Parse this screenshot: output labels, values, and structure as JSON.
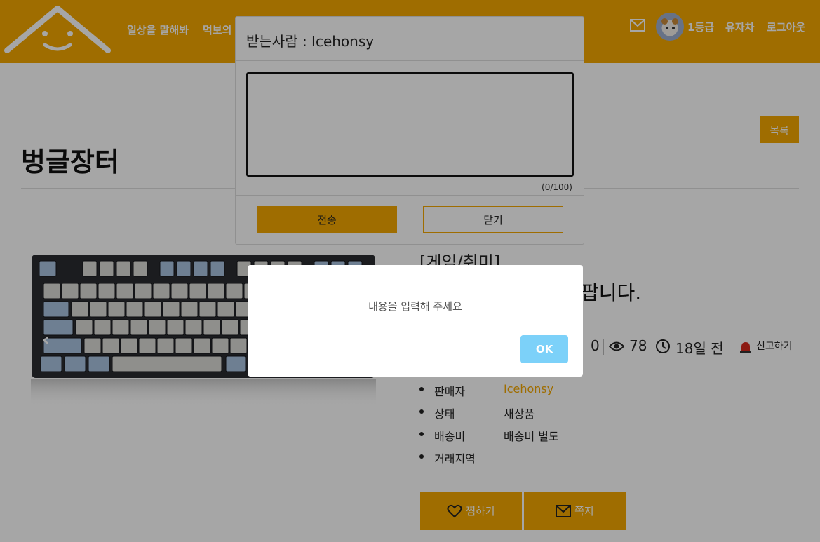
{
  "header": {
    "nav": [
      "일상을 말해봐",
      "먹보의"
    ],
    "grade": "1등급",
    "user_name": "유자차",
    "logout": "로그아웃",
    "brand_color": "#f5a800"
  },
  "page": {
    "list_button": "목록",
    "title": "벙글장터"
  },
  "post": {
    "category": "[게임/취미]",
    "title_visible": "팝니다.",
    "comments": "0",
    "views": "78",
    "time": "18일 전",
    "report": "신고하기",
    "info": [
      {
        "key": "판매자",
        "value": "Icehonsy"
      },
      {
        "key": "상태",
        "value": "새상품"
      },
      {
        "key": "배송비",
        "value": "배송비 별도"
      },
      {
        "key": "거래지역",
        "value": ""
      }
    ],
    "wish_button": "찜하기",
    "message_button": "쪽지"
  },
  "message_modal": {
    "recipient_label": "받는사람 : Icehonsy",
    "textarea_value": "",
    "counter": "(0/100)",
    "send_button": "전송",
    "close_button": "닫기"
  },
  "alert": {
    "message": "내용을 입력해 주세요",
    "ok_button": "OK",
    "ok_color": "#7cd1f9"
  }
}
